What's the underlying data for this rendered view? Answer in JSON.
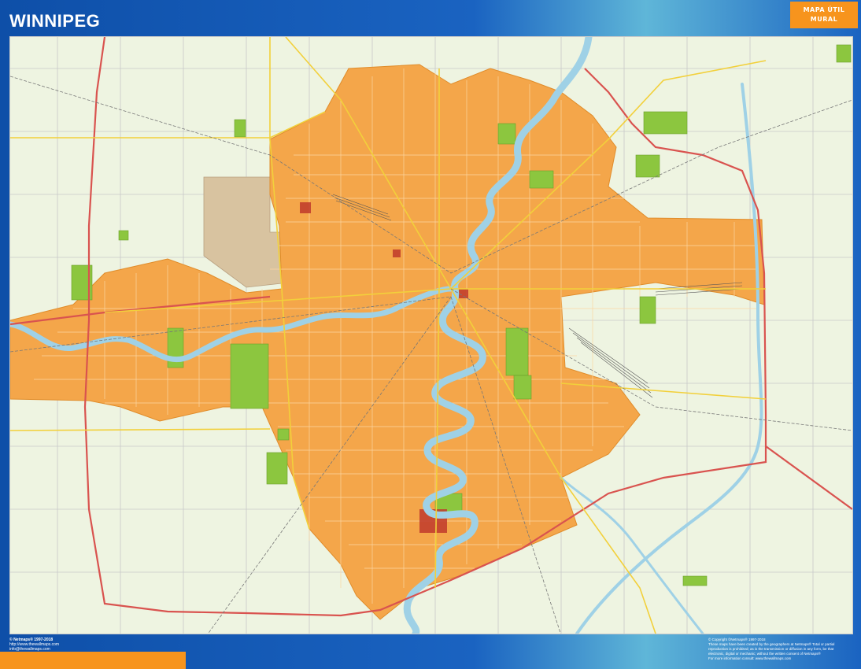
{
  "header": {
    "title": "WINNIPEG",
    "brand_line1": "MAPA ÚTIL",
    "brand_line2": "MURAL"
  },
  "footer": {
    "left_line1": "© Netmaps® 1997-2018",
    "left_line2": "http://www.thewallmaps.com",
    "left_line3": "info@thewallmaps.com",
    "right_line1": "© Copyright ©Netmaps® 1997-2018",
    "right_line2": "These maps have been created by the geographers at Netmaps® Total or partial",
    "right_line3": "reproduction is prohibited; as is the transmission or diffusion in any form, be that",
    "right_line4": "electronic, digital or mechanic; without the written consent of Netmaps®",
    "right_line5": "For more information consult: www.thewallmaps.com"
  },
  "colors": {
    "frame": "#1a63c1",
    "brand": "#f7941d",
    "urban": "#f4a64a",
    "rural": "#eef4e1",
    "river": "#9fd1e6",
    "park": "#8cc63f",
    "highway": "#d9534f",
    "road": "#f2d03b",
    "airport": "#d8c3a0"
  },
  "map": {
    "city": "Winnipeg"
  }
}
